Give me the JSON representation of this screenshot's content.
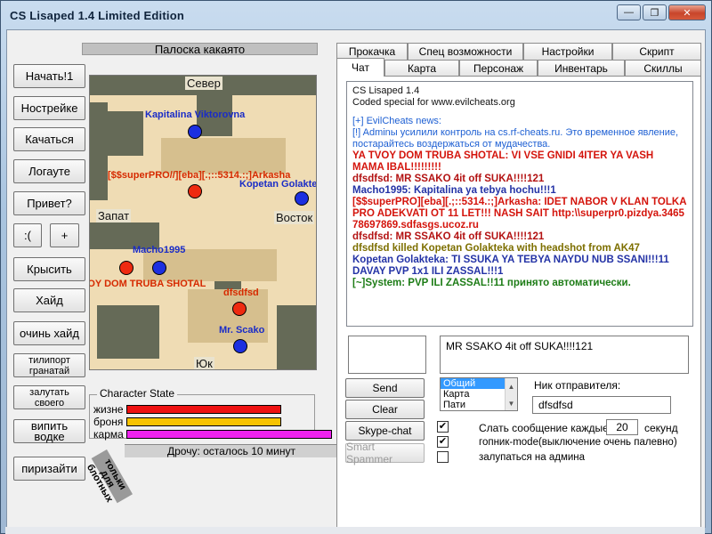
{
  "window": {
    "title": "CS Lisaped 1.4 Limited Edition",
    "min": "—",
    "max": "❐",
    "close": "✕"
  },
  "progress_label": "Палоска какаято",
  "left_buttons": [
    "Начать!1",
    "Нострейке",
    "Качаться",
    "Логауте",
    "Привет?",
    ":(",
    "+",
    "Крысить",
    "Хайд",
    "очинь хайд",
    "тилипорт гранатай",
    "залутать своего",
    "випить водке",
    "пиризайти"
  ],
  "map": {
    "directions": {
      "north": "Север",
      "west": "Запат",
      "east": "Восток",
      "south": "Юк"
    },
    "players": [
      {
        "name": "Kapitalina Viktorovna",
        "team": "blue"
      },
      {
        "name": "[$$superPRO//][eba][.;::5314.:;]Arkasha",
        "team": "red"
      },
      {
        "name": "Kopetan Golakteka",
        "team": "blue"
      },
      {
        "name": "Macho1995",
        "team": "blue"
      },
      {
        "name": "VOY DOM TRUBA SHOTAL",
        "team": "red"
      },
      {
        "name": "dfsdfsd",
        "team": "red"
      },
      {
        "name": "Mr. Scako",
        "team": "blue"
      }
    ]
  },
  "character_state": {
    "legend": "Character State",
    "rows": [
      {
        "label": "жизне",
        "color": "#ee1111",
        "level": 0.85
      },
      {
        "label": "броня",
        "color": "#f7c300",
        "level": 0.85
      },
      {
        "label": "карма",
        "color": "#ee22ee",
        "level": 1.0
      }
    ]
  },
  "status_text": "Дрочу: осталось 10 минут",
  "rotated_label": "тольки для блотных",
  "tabs_row1": [
    "Прокачка",
    "Спец возможности",
    "Настройки",
    "Скрипт"
  ],
  "tabs_row2": [
    "Чат",
    "Карта",
    "Персонаж",
    "Инвентарь",
    "Скиллы"
  ],
  "chat_lines": [
    {
      "text": "CS Lisaped 1.4",
      "style": "c-black"
    },
    {
      "text": "Coded special for www.evilcheats.org",
      "style": "c-black"
    },
    {
      "text": "",
      "style": "c-black"
    },
    {
      "text": "[+] EvilCheats news:",
      "style": "c-blue"
    },
    {
      "text": "[!] Adminы усилили контроль на cs.rf-cheats.ru. Это временное явление, постарайтесь воздержаться от мудачества.",
      "style": "c-blue"
    },
    {
      "text": "YA TVOY DOM TRUBA SHOTAL: VI VSE GNIDI 4ITER YA VASH MAMA IBAL!!!!!!!!!",
      "style": "c-red m-bold"
    },
    {
      "text": "dfsdfsd: MR SSAKO 4it off SUKA!!!!121",
      "style": "c-dred m-bold"
    },
    {
      "text": "Macho1995: Kapitalina ya tebya hochu!!!1",
      "style": "c-navy m-bold"
    },
    {
      "text": "[$$superPRO][eba][.;::5314.:;]Arkasha: IDET NABOR V KLAN TOLKA PRO ADEKVATI OT 11 LET!!! NASH SAIT http:\\\\superpr0.pizdya.3465 78697869.sdfasgs.ucoz.ru",
      "style": "c-red m-bold"
    },
    {
      "text": "dfsdfsd: MR SSAKO 4it off SUKA!!!!121",
      "style": "c-dred m-bold"
    },
    {
      "text": "dfsdfsd killed Kopetan Golakteka with headshot from AK47",
      "style": "c-olive m-bold"
    },
    {
      "text": "Kopetan Golakteka: TI SSUKA YA TEBYA NAYDU NUB SSANI!!!11 DAVAY PVP 1x1 ILI ZASSAL!!!1",
      "style": "c-navy m-bold"
    },
    {
      "text": "[~]System: PVP ILI ZASSAL!!11 принято автоматически.",
      "style": "c-green m-bold"
    }
  ],
  "message_input": "MR SSAKO 4it off SUKA!!!!121",
  "buttons": {
    "send": "Send",
    "clear": "Clear",
    "skype": "Skype-chat",
    "spammer": "Smart Spammer"
  },
  "channels": [
    "Общий",
    "Карта",
    "Пати"
  ],
  "sender_label": "Ник отправителя:",
  "sender_value": "dfsdfsd",
  "options": {
    "repeat_prefix": "Слать сообщение каждые",
    "repeat_value": "20",
    "repeat_suffix": "секунд",
    "gopnik": "гопник-mode(выключение очень палевно)",
    "admin": "залупаться на админа"
  }
}
